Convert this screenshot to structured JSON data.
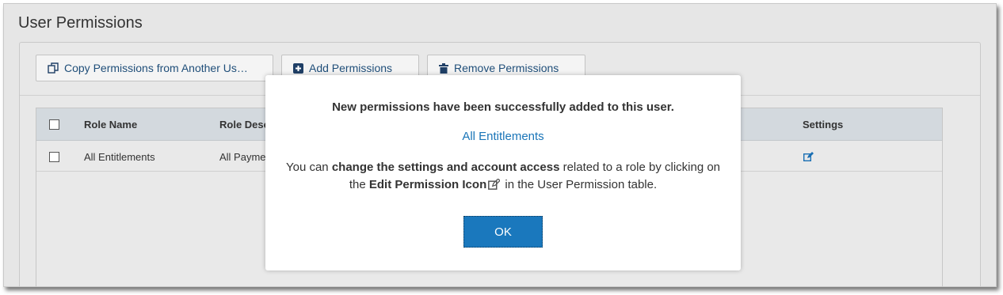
{
  "page": {
    "title": "User Permissions"
  },
  "toolbar": {
    "copy_label": "Copy Permissions from Another Us…",
    "add_label": "Add Permissions",
    "remove_label": "Remove Permissions"
  },
  "table": {
    "headers": {
      "role_name": "Role Name",
      "role_desc": "Role Desc",
      "settings": "Settings"
    },
    "rows": [
      {
        "role_name": "All Entitlements",
        "role_desc": "All Payme",
        "settings_icon": "edit-icon"
      }
    ]
  },
  "modal": {
    "title": "New permissions have been successfully added to this user.",
    "link": "All Entitlements",
    "body_pre": "You can ",
    "body_bold1": "change the settings and account access",
    "body_mid": " related to a role by clicking on the ",
    "body_bold2": "Edit Permission Icon",
    "body_post": " in the User Permission table.",
    "ok_label": "OK"
  },
  "colors": {
    "accent": "#1a78bd",
    "link": "#1a75b8",
    "header_bg": "#d3d9de",
    "button_text": "#1f4e79"
  }
}
